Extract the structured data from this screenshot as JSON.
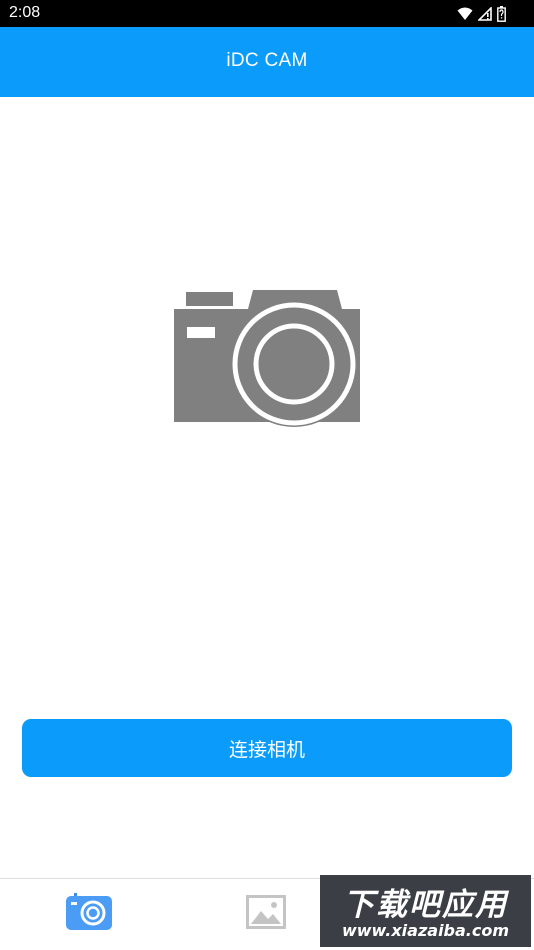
{
  "status_bar": {
    "time": "2:08",
    "icons": [
      "wifi-icon",
      "cellular-signal-icon",
      "battery-icon"
    ]
  },
  "app_bar": {
    "title": "iDC CAM"
  },
  "main": {
    "hero_icon": "camera-icon",
    "connect_button_label": "连接相机"
  },
  "tab_bar": {
    "tabs": [
      {
        "icon": "camera-icon",
        "selected": true
      },
      {
        "icon": "image-icon",
        "selected": false
      }
    ]
  },
  "watermark": {
    "line1": "下载吧应用",
    "line2": "www.xiazaiba.com"
  },
  "colors": {
    "accent": "#0a9bfb",
    "icon_gray": "#808080",
    "tab_icon_inactive": "#c4c4c4",
    "tab_icon_active": "#3b8ef0"
  }
}
